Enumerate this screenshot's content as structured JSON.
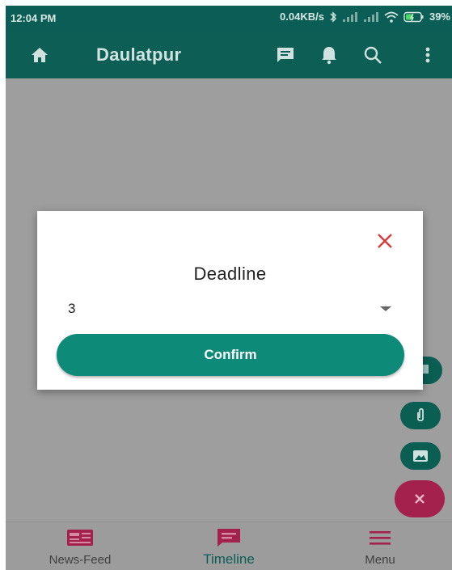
{
  "status_bar": {
    "time": "12:04 PM",
    "network_speed": "0.04KB/s",
    "battery": "39%"
  },
  "app_bar": {
    "title": "Daulatpur",
    "icons": [
      "home-icon",
      "chat-icon",
      "bell-icon",
      "search-icon",
      "more-vert-icon"
    ]
  },
  "dialog": {
    "title": "Deadline",
    "dropdown": {
      "selected_value": "3"
    },
    "confirm_label": "Confirm"
  },
  "fabs": [
    "chat-icon",
    "attach-icon",
    "image-icon",
    "close-icon"
  ],
  "bottom_nav": {
    "items": [
      {
        "label": "News-Feed",
        "icon": "newspaper-icon",
        "active": false
      },
      {
        "label": "Timeline",
        "icon": "chat-icon",
        "active": true
      },
      {
        "label": "Menu",
        "icon": "menu-icon",
        "active": false
      }
    ]
  },
  "colors": {
    "primary": "#0d5f56",
    "accent": "#0d8a78",
    "close_red": "#d93a3a",
    "fab_pink": "#a3214c"
  }
}
